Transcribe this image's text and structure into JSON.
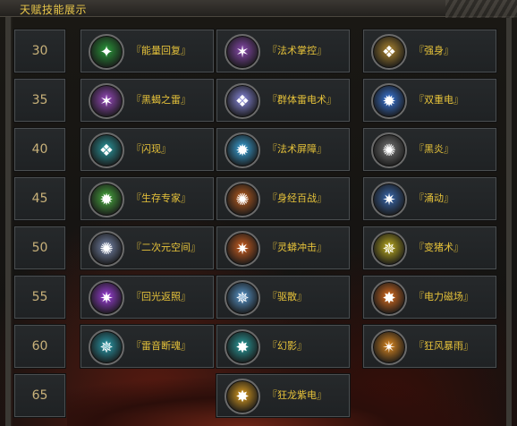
{
  "window": {
    "title": "天赋技能展示"
  },
  "rows": [
    {
      "level": "30",
      "skills": [
        {
          "name": "『能量回复』",
          "icon": "green-energy-icon",
          "color": "#2a9a3a"
        },
        {
          "name": "『法术掌控』",
          "icon": "purple-claw-icon",
          "color": "#8a4ab0"
        },
        {
          "name": "『强身』",
          "icon": "gold-armor-icon",
          "color": "#b08830"
        }
      ]
    },
    {
      "level": "35",
      "skills": [
        {
          "name": "『黑蝎之雷』",
          "icon": "purple-scorpion-icon",
          "color": "#9a4ac0"
        },
        {
          "name": "『群体雷电术』",
          "icon": "lightning-storm-icon",
          "color": "#8a8ae0"
        },
        {
          "name": "『双重电』",
          "icon": "blue-lightning-icon",
          "color": "#3a7ae0"
        }
      ]
    },
    {
      "level": "40",
      "skills": [
        {
          "name": "『闪现』",
          "icon": "teal-dash-icon",
          "color": "#2a9aa0"
        },
        {
          "name": "『法术屏障』",
          "icon": "blue-orb-icon",
          "color": "#3aa8e0"
        },
        {
          "name": "『黑炎』",
          "icon": "dark-figure-icon",
          "color": "#777777"
        }
      ]
    },
    {
      "level": "45",
      "skills": [
        {
          "name": "『生存专家』",
          "icon": "green-runner-icon",
          "color": "#4ab040"
        },
        {
          "name": "『身经百战』",
          "icon": "fire-warrior-icon",
          "color": "#c06020"
        },
        {
          "name": "『涌动』",
          "icon": "blue-wave-icon",
          "color": "#3a6ab0"
        }
      ]
    },
    {
      "level": "50",
      "skills": [
        {
          "name": "『二次元空间』",
          "icon": "star-orbit-icon",
          "color": "#7a8ab0"
        },
        {
          "name": "『灵蟒冲击』",
          "icon": "fire-serpent-icon",
          "color": "#d06020"
        },
        {
          "name": "『变猪术』",
          "icon": "yellow-ring-icon",
          "color": "#c0b020"
        }
      ]
    },
    {
      "level": "55",
      "skills": [
        {
          "name": "『回光返照』",
          "icon": "violet-glow-icon",
          "color": "#a040e0"
        },
        {
          "name": "『驱散』",
          "icon": "blue-phoenix-icon",
          "color": "#5a9ad0"
        },
        {
          "name": "『电力磁场』",
          "icon": "orange-spark-icon",
          "color": "#e07020"
        }
      ]
    },
    {
      "level": "60",
      "skills": [
        {
          "name": "『雷音断魂』",
          "icon": "teal-blade-icon",
          "color": "#2aa0b0"
        },
        {
          "name": "『幻影』",
          "icon": "teal-phantom-icon",
          "color": "#2aa0a0"
        },
        {
          "name": "『狂风暴雨』",
          "icon": "fire-burst-icon",
          "color": "#e08a20"
        }
      ]
    },
    {
      "level": "65",
      "skills": [
        {
          "name": "『狂龙紫电』",
          "icon": "golden-flame-icon",
          "color": "#e0a020"
        }
      ]
    }
  ]
}
